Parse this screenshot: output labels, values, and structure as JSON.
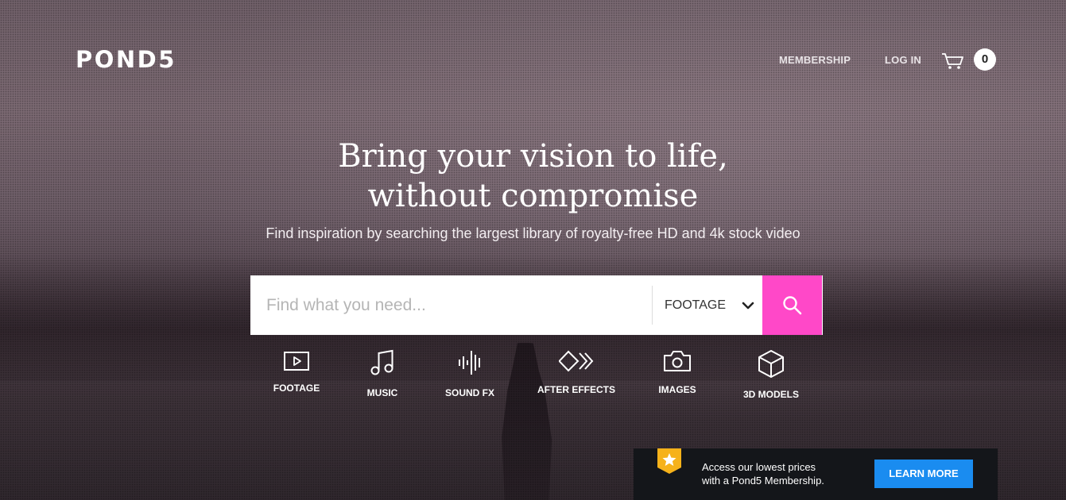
{
  "brand": {
    "logo_text": "POND5"
  },
  "header": {
    "membership_label": "MEMBERSHIP",
    "login_label": "LOG IN",
    "cart_icon": "cart-icon",
    "cart_count": "0"
  },
  "hero": {
    "headline_line1": "Bring your vision to life,",
    "headline_line2": "without compromise",
    "subheadline": "Find inspiration by searching the largest library of royalty-free HD and 4k stock video"
  },
  "search": {
    "placeholder": "Find what you need...",
    "value": "",
    "selected_type": "FOOTAGE",
    "button_icon": "search-icon",
    "button_color": "#ff48c8"
  },
  "categories": [
    {
      "label": "FOOTAGE",
      "icon": "play-icon"
    },
    {
      "label": "MUSIC",
      "icon": "music-note-icon"
    },
    {
      "label": "SOUND FX",
      "icon": "waveform-icon"
    },
    {
      "label": "AFTER EFFECTS",
      "icon": "after-effects-icon"
    },
    {
      "label": "IMAGES",
      "icon": "camera-icon"
    },
    {
      "label": "3D MODELS",
      "icon": "cube-icon"
    }
  ],
  "banner": {
    "line1": "Access our lowest prices",
    "line2": "with a Pond5 Membership.",
    "button_label": "LEARN MORE",
    "badge_icon": "star-icon",
    "button_color": "#1a8cf0"
  }
}
